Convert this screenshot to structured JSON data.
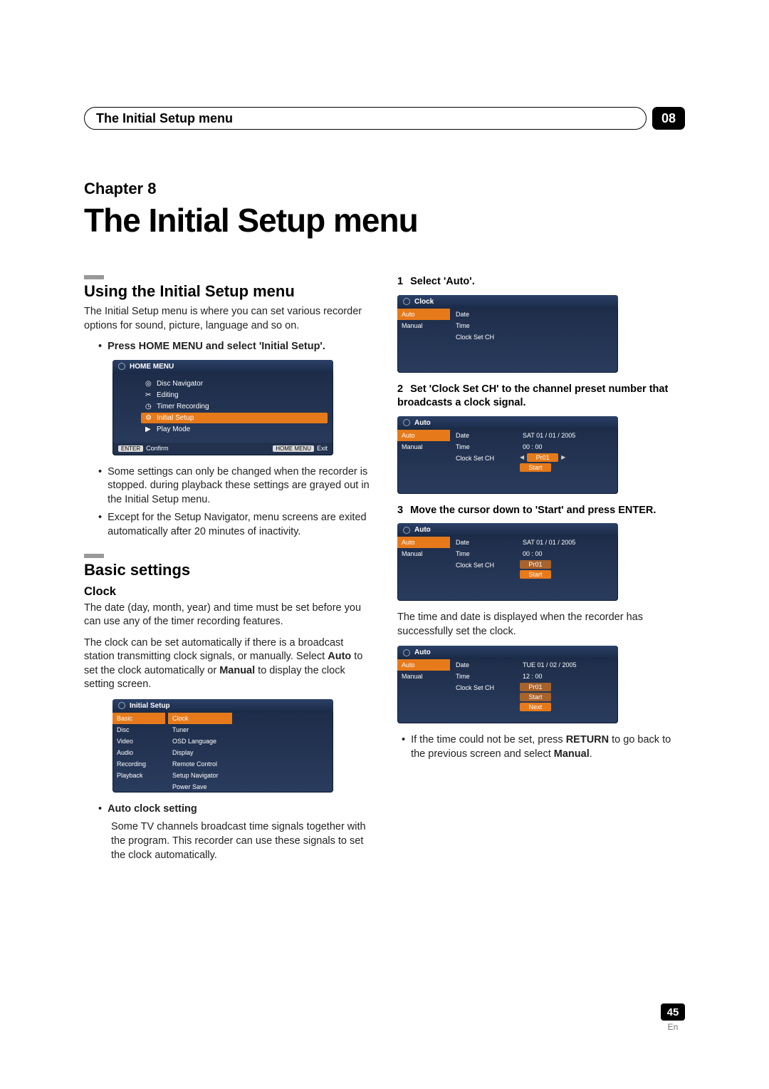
{
  "header": {
    "title": "The Initial Setup menu",
    "chapter_number": "08"
  },
  "chapter": {
    "label": "Chapter 8",
    "title": "The Initial Setup menu"
  },
  "left": {
    "sec1_title": "Using the Initial Setup menu",
    "sec1_body": "The Initial Setup menu is where you can set various recorder options for sound, picture, language and so on.",
    "step_press": "Press HOME MENU and select 'Initial Setup'.",
    "home_menu": {
      "title": "HOME MENU",
      "items": [
        "Disc Navigator",
        "Editing",
        "Timer Recording",
        "Initial Setup",
        "Play Mode"
      ],
      "selected_index": 3,
      "footer_left_btn": "ENTER",
      "footer_left": "Confirm",
      "footer_right_btn": "HOME MENU",
      "footer_right": "Exit"
    },
    "note1": "Some settings can only be changed when the recorder is stopped. during playback these settings are grayed out in the Initial Setup menu.",
    "note2": "Except for the Setup Navigator, menu screens are exited automatically after 20 minutes of inactivity.",
    "sec2_title": "Basic settings",
    "clock_title": "Clock",
    "clock_p1": "The date (day, month, year) and time must be set before you can use any of the timer recording features.",
    "clock_p2_a": "The clock can be set automatically if there is a broadcast station transmitting clock signals, or manually. Select ",
    "clock_p2_b": "Auto",
    "clock_p2_c": " to set the clock automatically or ",
    "clock_p2_d": "Manual",
    "clock_p2_e": " to display the clock setting screen.",
    "initial_setup_osd": {
      "title": "Initial Setup",
      "left": [
        "Basic",
        "Disc",
        "Video",
        "Audio",
        "Recording",
        "Playback"
      ],
      "left_selected": 0,
      "right": [
        "Clock",
        "Tuner",
        "OSD Language",
        "Display",
        "Remote Control",
        "Setup Navigator",
        "Power Save"
      ],
      "right_selected": 0
    },
    "auto_clock_title": "Auto clock setting",
    "auto_clock_body": "Some TV channels broadcast time signals together with the program. This recorder can use these signals to set the clock automatically."
  },
  "right": {
    "step1": "Select 'Auto'.",
    "osd1": {
      "title": "Clock",
      "tabs": [
        "Auto",
        "Manual"
      ],
      "tab_selected": 0,
      "fields": [
        "Date",
        "Time",
        "Clock Set CH"
      ]
    },
    "step2": "Set 'Clock Set CH' to the channel preset number that broadcasts a clock signal.",
    "osd2": {
      "title": "Auto",
      "tabs": [
        "Auto",
        "Manual"
      ],
      "date_label": "Date",
      "date_value": "SAT  01  /  01  /  2005",
      "time_label": "Time",
      "time_value": "00  :  00",
      "ch_label": "Clock Set CH",
      "ch_value": "Pr01",
      "start_label": "Start"
    },
    "step3_a": "Move the cursor down to 'Start' and press ",
    "step3_b": "ENTER",
    "step3_c": ".",
    "osd3": {
      "title": "Auto",
      "tabs": [
        "Auto",
        "Manual"
      ],
      "date_label": "Date",
      "date_value": "SAT  01  /  01  /  2005",
      "time_label": "Time",
      "time_value": "00  :  00",
      "ch_label": "Clock Set CH",
      "ch_value": "Pr01",
      "start_label": "Start"
    },
    "result_text": "The time and date is displayed when the recorder has successfully set the clock.",
    "osd4": {
      "title": "Auto",
      "tabs": [
        "Auto",
        "Manual"
      ],
      "date_label": "Date",
      "date_value": "TUE  01  /  02  /  2005",
      "time_label": "Time",
      "time_value": "12  :  00",
      "ch_label": "Clock Set CH",
      "ch_value": "Pr01",
      "start_label": "Start",
      "next_label": "Next"
    },
    "fail_note_a": "If the time could not be set, press ",
    "fail_note_b": "RETURN",
    "fail_note_c": " to go back to the previous screen and select ",
    "fail_note_d": "Manual",
    "fail_note_e": "."
  },
  "footer": {
    "page_number": "45",
    "lang": "En"
  }
}
